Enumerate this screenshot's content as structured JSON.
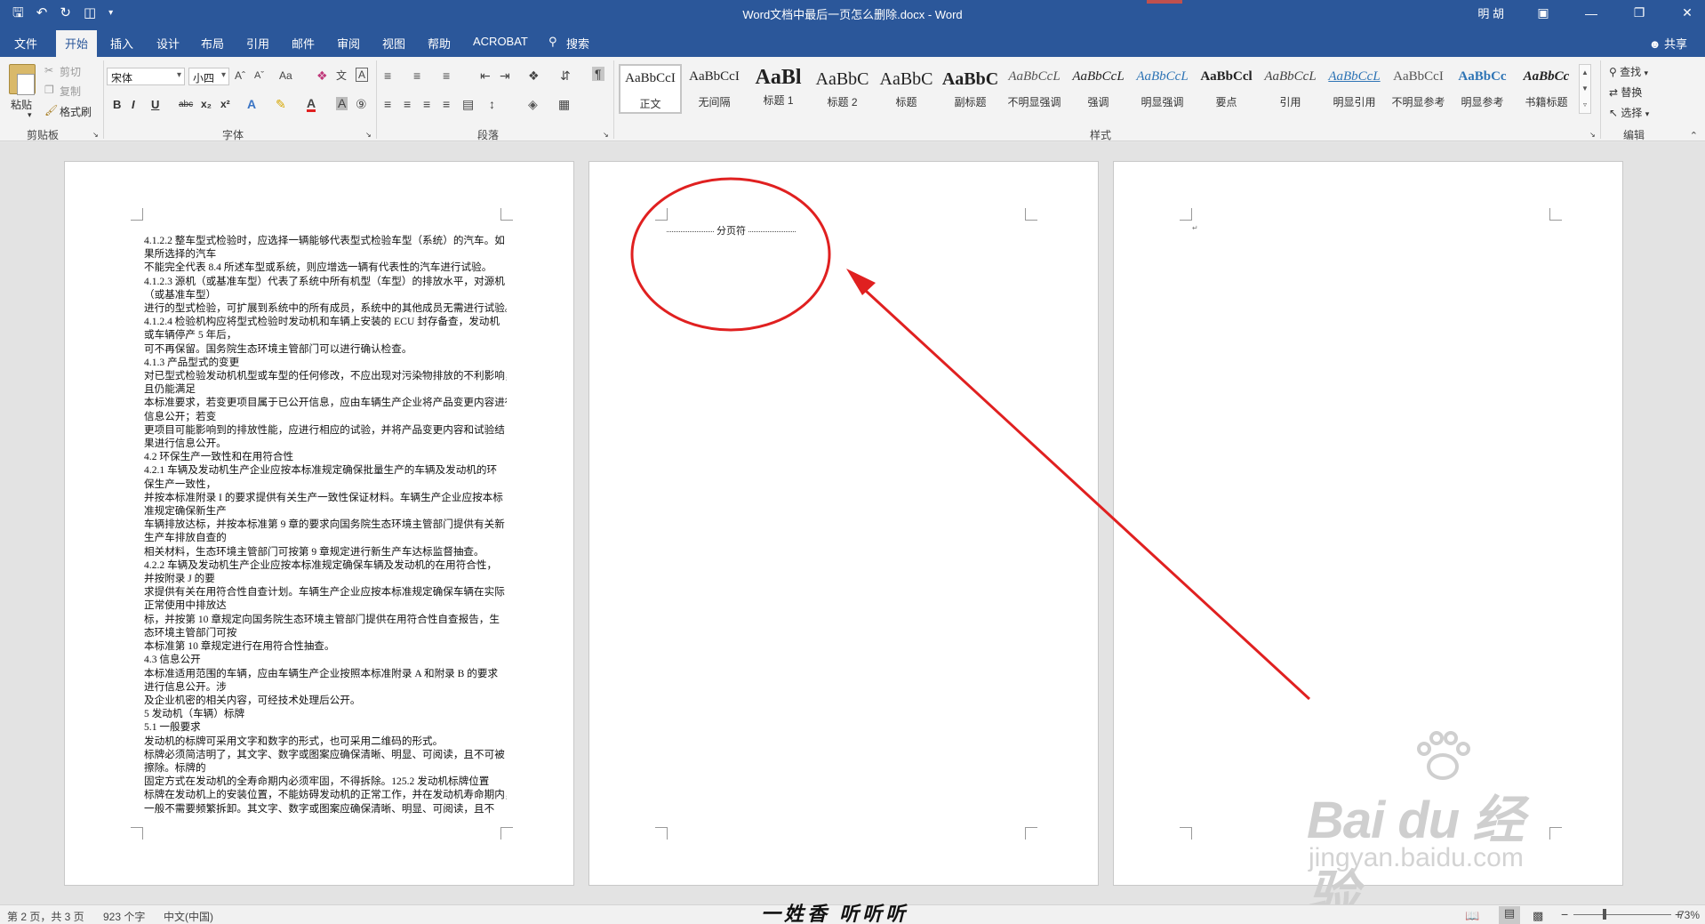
{
  "window": {
    "title": "Word文档中最后一页怎么删除.docx  -  Word",
    "user": "明 胡"
  },
  "qat": {
    "save_icon": "save-icon",
    "undo_icon": "undo-icon",
    "redo_icon": "redo-icon",
    "preview_icon": "print-preview-icon"
  },
  "tabs": [
    {
      "label": "文件"
    },
    {
      "label": "开始"
    },
    {
      "label": "插入"
    },
    {
      "label": "设计"
    },
    {
      "label": "布局"
    },
    {
      "label": "引用"
    },
    {
      "label": "邮件"
    },
    {
      "label": "审阅"
    },
    {
      "label": "视图"
    },
    {
      "label": "帮助"
    },
    {
      "label": "ACROBAT"
    },
    {
      "label": "搜索"
    }
  ],
  "share_label": "共享",
  "ribbon": {
    "clipboard": {
      "paste": "粘贴",
      "cut": "剪切",
      "copy": "复制",
      "format_painter": "格式刷",
      "group": "剪贴板"
    },
    "font": {
      "font_name": "宋体",
      "font_size": "小四",
      "group": "字体",
      "change_case": "Aa",
      "bold": "B",
      "italic": "I",
      "underline": "U",
      "strike": "abc",
      "subscript": "x₂",
      "superscript": "x²"
    },
    "paragraph": {
      "group": "段落"
    },
    "styles": {
      "group": "样式",
      "items": [
        {
          "sample": "AaBbCcI",
          "name": "正文"
        },
        {
          "sample": "AaBbCcI",
          "name": "无间隔"
        },
        {
          "sample": "AaBl",
          "name": "标题 1"
        },
        {
          "sample": "AaBbC",
          "name": "标题 2"
        },
        {
          "sample": "AaBbC",
          "name": "标题"
        },
        {
          "sample": "AaBbC",
          "name": "副标题"
        },
        {
          "sample": "AaBbCcL",
          "name": "不明显强调"
        },
        {
          "sample": "AaBbCcL",
          "name": "强调"
        },
        {
          "sample": "AaBbCcL",
          "name": "明显强调"
        },
        {
          "sample": "AaBbCcl",
          "name": "要点"
        },
        {
          "sample": "AaBbCcL",
          "name": "引用"
        },
        {
          "sample": "AaBbCcL",
          "name": "明显引用"
        },
        {
          "sample": "AaBbCcI",
          "name": "不明显参考"
        },
        {
          "sample": "AaBbCc",
          "name": "明显参考"
        },
        {
          "sample": "AaBbCc",
          "name": "书籍标题"
        }
      ]
    },
    "editing": {
      "find": "查找",
      "replace": "替换",
      "select": "选择",
      "group": "编辑"
    }
  },
  "document": {
    "page1_lines": [
      "4.1.2.2 整车型式检验时，应选择一辆能够代表型式检验车型（系统）的汽车。如",
      "果所选择的汽车",
      "不能完全代表 8.4 所述车型或系统，则应增选一辆有代表性的汽车进行试验。",
      "4.1.2.3 源机（或基准车型）代表了系统中所有机型（车型）的排放水平，对源机",
      "（或基准车型）",
      "进行的型式检验，可扩展到系统中的所有成员，系统中的其他成员无需进行试验。",
      "4.1.2.4 检验机构应将型式检验时发动机和车辆上安装的 ECU 封存备查，发动机",
      "或车辆停产 5 年后，",
      "可不再保留。国务院生态环境主管部门可以进行确认检查。",
      "4.1.3 产品型式的变更",
      "对已型式检验发动机机型或车型的任何修改，不应出现对污染物排放的不利影响，",
      "且仍能满足",
      "本标准要求，若变更项目属于已公开信息，应由车辆生产企业将产品变更内容进行",
      "信息公开；若变",
      "更项目可能影响到的排放性能，应进行相应的试验，并将产品变更内容和试验结",
      "果进行信息公开。",
      "4.2 环保生产一致性和在用符合性",
      "4.2.1 车辆及发动机生产企业应按本标准规定确保批量生产的车辆及发动机的环",
      "保生产一致性，",
      "并按本标准附录 I 的要求提供有关生产一致性保证材料。车辆生产企业应按本标",
      "准规定确保新生产",
      "车辆排放达标，并按本标准第 9 章的要求向国务院生态环境主管部门提供有关新",
      "生产车排放自查的",
      "相关材料，生态环境主管部门可按第 9 章规定进行新生产车达标监督抽查。",
      "4.2.2 车辆及发动机生产企业应按本标准规定确保车辆及发动机的在用符合性，",
      "并按附录 J 的要",
      "求提供有关在用符合性自查计划。车辆生产企业应按本标准规定确保车辆在实际",
      "正常使用中排放达",
      "标，并按第 10 章规定向国务院生态环境主管部门提供在用符合性自查报告，生",
      "态环境主管部门可按",
      "本标准第 10 章规定进行在用符合性抽查。",
      "4.3 信息公开",
      "本标准适用范围的车辆，应由车辆生产企业按照本标准附录 A 和附录 B 的要求",
      "进行信息公开。涉",
      "及企业机密的相关内容，可经技术处理后公开。",
      "5 发动机（车辆）标牌",
      "5.1 一般要求",
      "发动机的标牌可采用文字和数字的形式，也可采用二维码的形式。",
      "标牌必须简洁明了，其文字、数字或图案应确保清晰、明显、可阅读，且不可被",
      "擦除。标牌的",
      "固定方式在发动机的全寿命期内必须牢固，不得拆除。125.2 发动机标牌位置",
      "标牌在发动机上的安装位置，不能妨碍发动机的正常工作，并在发动机寿命期内，",
      "一般不需要频繁拆卸。其文字、数字或图案应确保清晰、明显、可阅读，且不"
    ],
    "page_break_label": "分页符"
  },
  "status": {
    "page_info": "第 2 页，共 3 页",
    "word_count": "923 个字",
    "language": "中文(中国)",
    "zoom": "73%"
  },
  "caption": "一姓香 听听听",
  "watermark": {
    "main": "Bai du 经验",
    "url": "jingyan.baidu.com"
  },
  "colors": {
    "word_blue": "#2b579a",
    "annotation_red": "#e02020"
  }
}
